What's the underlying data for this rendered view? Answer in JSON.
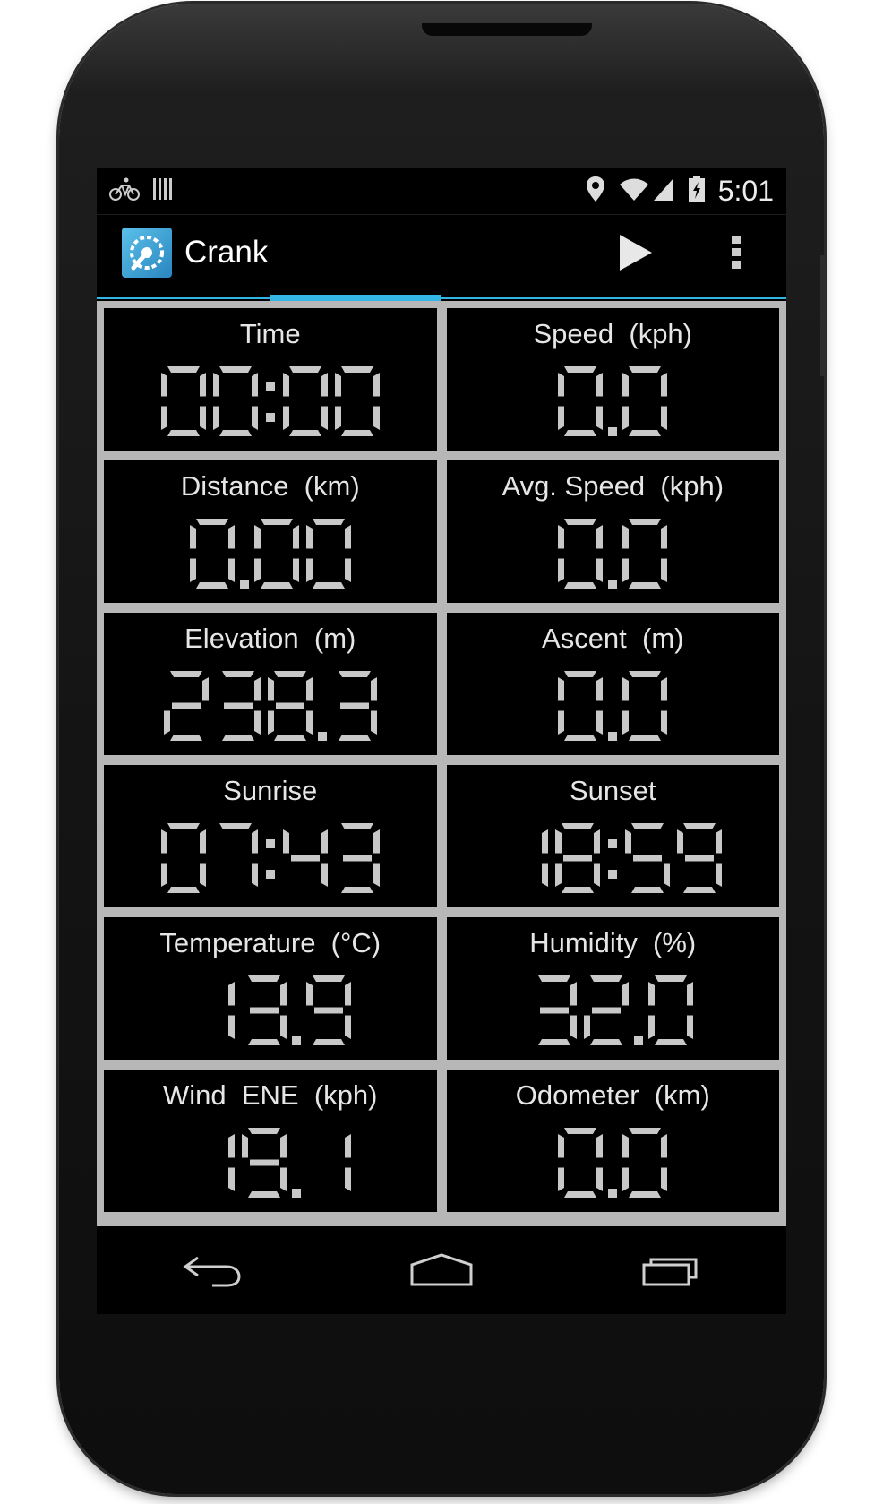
{
  "status_bar": {
    "time": "5:01",
    "left_icons": [
      "bicycle-icon",
      "barcode-icon"
    ],
    "right_icons": [
      "location-icon",
      "wifi-icon",
      "signal-icon",
      "battery-charging-icon"
    ]
  },
  "action_bar": {
    "title": "Crank",
    "app_icon": "crank-app-icon",
    "actions": [
      "play-icon",
      "overflow-menu-icon"
    ]
  },
  "tabs": {
    "count": 4,
    "active_index": 1,
    "accent_color": "#33b5e5"
  },
  "metrics": [
    {
      "label": "Time",
      "value": "00:00"
    },
    {
      "label": "Speed  (kph)",
      "value": "0.0"
    },
    {
      "label": "Distance  (km)",
      "value": "0.00"
    },
    {
      "label": "Avg. Speed  (kph)",
      "value": "0.0"
    },
    {
      "label": "Elevation  (m)",
      "value": "238.3"
    },
    {
      "label": "Ascent  (m)",
      "value": "0.0"
    },
    {
      "label": "Sunrise",
      "value": "07:43"
    },
    {
      "label": "Sunset",
      "value": "18:59"
    },
    {
      "label": "Temperature  (°C)",
      "value": "13.9"
    },
    {
      "label": "Humidity  (%)",
      "value": "32.0"
    },
    {
      "label": "Wind  ENE  (kph)",
      "value": "19.1"
    },
    {
      "label": "Odometer  (km)",
      "value": "0.0"
    }
  ],
  "nav_bar": [
    "back-icon",
    "home-icon",
    "recent-apps-icon"
  ],
  "colors": {
    "grid_border": "#b7b7b7",
    "digit": "#c8c8c8",
    "background": "#000000"
  }
}
